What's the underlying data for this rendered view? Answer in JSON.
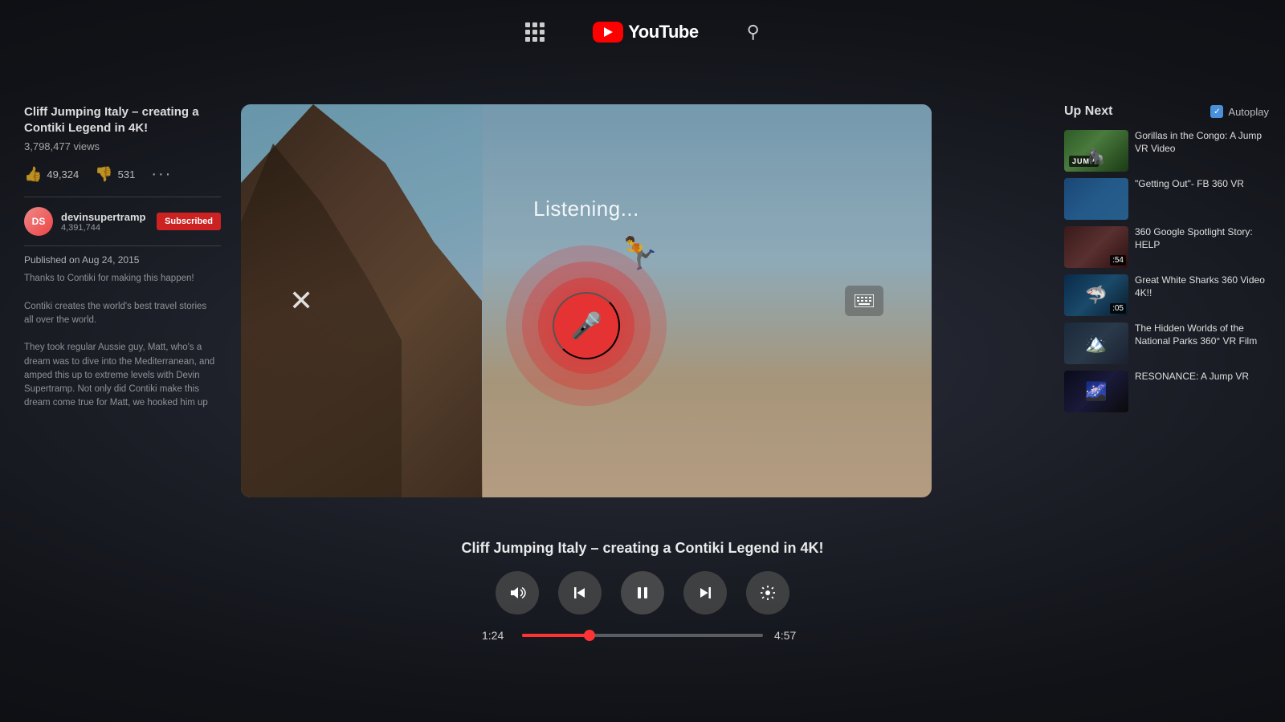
{
  "nav": {
    "grid_icon": "grid-icon",
    "search_icon": "search-icon",
    "youtube_text": "YouTube"
  },
  "video": {
    "title": "Cliff Jumping Italy – creating a Contiki Legend in 4K!",
    "views": "3,798,477 views",
    "likes": "49,324",
    "dislikes": "531",
    "channel_name": "devinsupertramp",
    "channel_subs": "4,391,744",
    "subscribe_label": "Subscribed",
    "published_date": "Published on Aug 24, 2015",
    "description_line1": "Thanks to Contiki for making this happen!",
    "description_line2": "Contiki creates the world's best travel stories",
    "description_line3": "all over the world.",
    "description_line4": "They took regular Aussie guy, Matt, who's a",
    "description_line5": "dream was to dive into the Mediterranean, and",
    "description_line6": "amped this up to extreme levels with Devin",
    "description_line7": "Supertramp. Not only did Contiki make this",
    "description_line8": "dream come true for Matt, we hooked him up",
    "voice_listening": "Listening...",
    "current_time": "1:24",
    "total_time": "4:57",
    "progress_pct": 28.4,
    "bottom_title": "Cliff Jumping Italy – creating a Contiki Legend in 4K!"
  },
  "sidebar_right": {
    "up_next_label": "Up Next",
    "autoplay_label": "Autoplay",
    "items": [
      {
        "title": "Gorillas in the Congo: A Jump VR Video",
        "duration": "",
        "thumb_type": "gorillas",
        "badge": "JUMP"
      },
      {
        "title": "\"Getting Out\"- FB 360 VR",
        "duration": "",
        "thumb_type": "getting-out"
      },
      {
        "title": "360 Google Spotlight Story: HELP",
        "duration": ":54",
        "thumb_type": "google-spotlight"
      },
      {
        "title": "Great White Sharks 360 Video 4K!!",
        "duration": ":05",
        "thumb_type": "sharks"
      },
      {
        "title": "The Hidden Worlds of the National Parks 360° VR Film",
        "duration": "",
        "thumb_type": "hidden-worlds"
      },
      {
        "title": "RESONANCE: A Jump VR",
        "duration": "",
        "thumb_type": "resonance"
      }
    ]
  }
}
